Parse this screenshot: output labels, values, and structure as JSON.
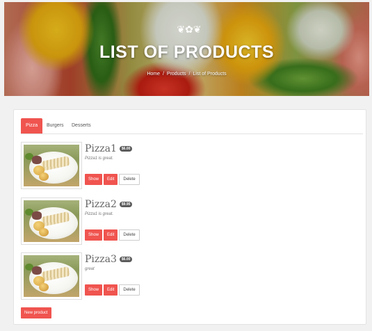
{
  "header": {
    "ornament": "❦✿❦",
    "title": "LIST OF PRODUCTS",
    "breadcrumb": [
      "Home",
      "Products",
      "List of Products"
    ],
    "separator": "/"
  },
  "tabs": [
    {
      "label": "Pizza",
      "active": true
    },
    {
      "label": "Burgers",
      "active": false
    },
    {
      "label": "Desserts",
      "active": false
    }
  ],
  "products": [
    {
      "name": "Pizza1",
      "price": "$6.00",
      "description": "Pizza1 is great."
    },
    {
      "name": "Pizza2",
      "price": "$9.95",
      "description": "Pizza1 is great."
    },
    {
      "name": "Pizza3",
      "price": "$6.00",
      "description": "great"
    }
  ],
  "actions": {
    "show": "Show",
    "edit": "Edit",
    "delete": "Delete"
  },
  "new_product_label": "New product",
  "colors": {
    "accent": "#f0544f",
    "badge": "#5b5b5b"
  }
}
